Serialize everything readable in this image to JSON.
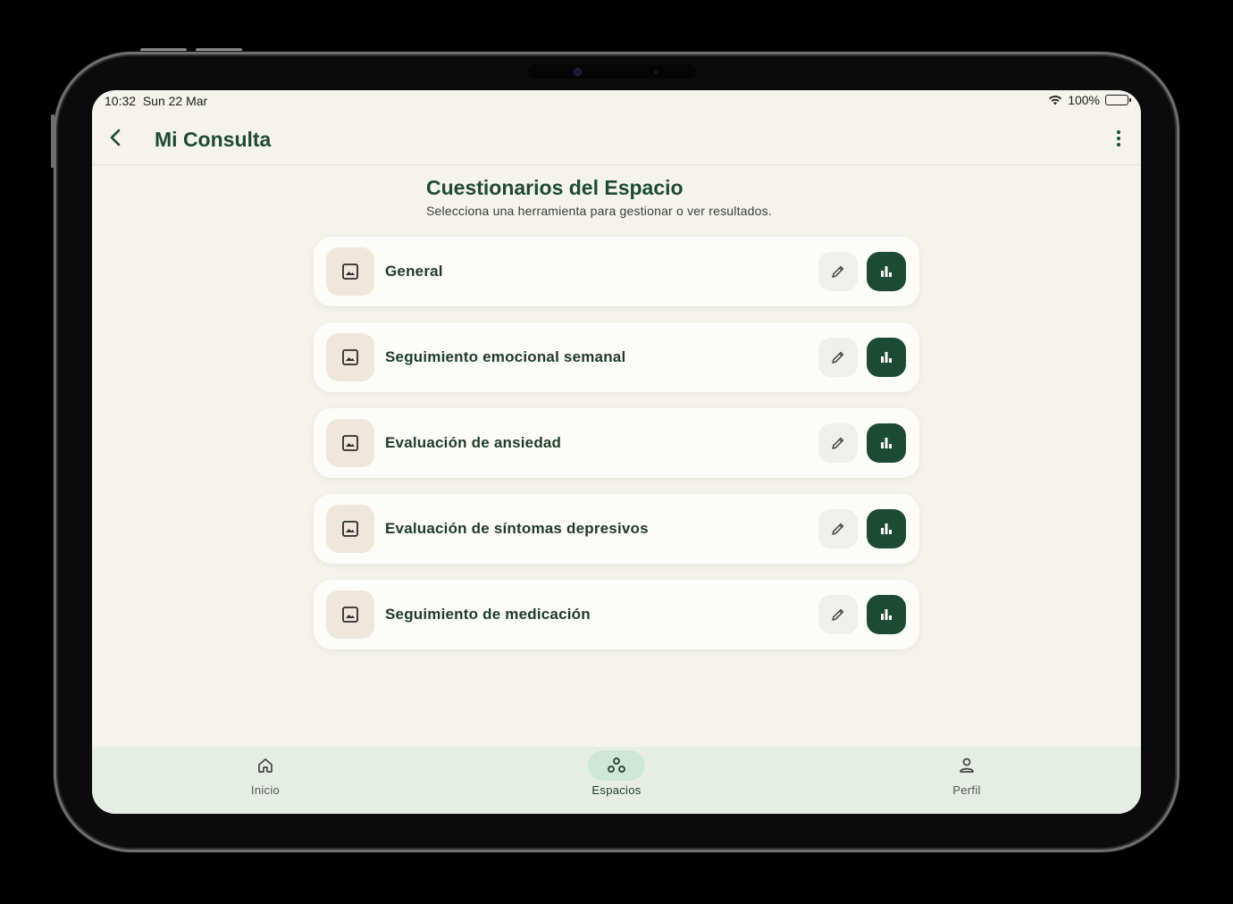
{
  "status": {
    "time": "10:32",
    "date": "Sun 22 Mar",
    "battery": "100%"
  },
  "header": {
    "title": "Mi Consulta"
  },
  "section": {
    "title": "Cuestionarios del Espacio",
    "subtitle": "Selecciona una herramienta para gestionar o ver resultados."
  },
  "questionnaires": [
    {
      "title": "General"
    },
    {
      "title": "Seguimiento emocional semanal"
    },
    {
      "title": "Evaluación de ansiedad"
    },
    {
      "title": "Evaluación de síntomas depresivos"
    },
    {
      "title": "Seguimiento de medicación"
    }
  ],
  "nav": {
    "items": [
      {
        "label": "Inicio",
        "icon": "home-icon"
      },
      {
        "label": "Espacios",
        "icon": "spaces-icon",
        "active": true
      },
      {
        "label": "Perfil",
        "icon": "person-icon"
      }
    ]
  },
  "colors": {
    "primary": "#1d4a34",
    "background": "#f4f3ec",
    "thumb": "#efe6dc",
    "nav": "#e6ede5",
    "nav_active": "#cfe7d6"
  }
}
